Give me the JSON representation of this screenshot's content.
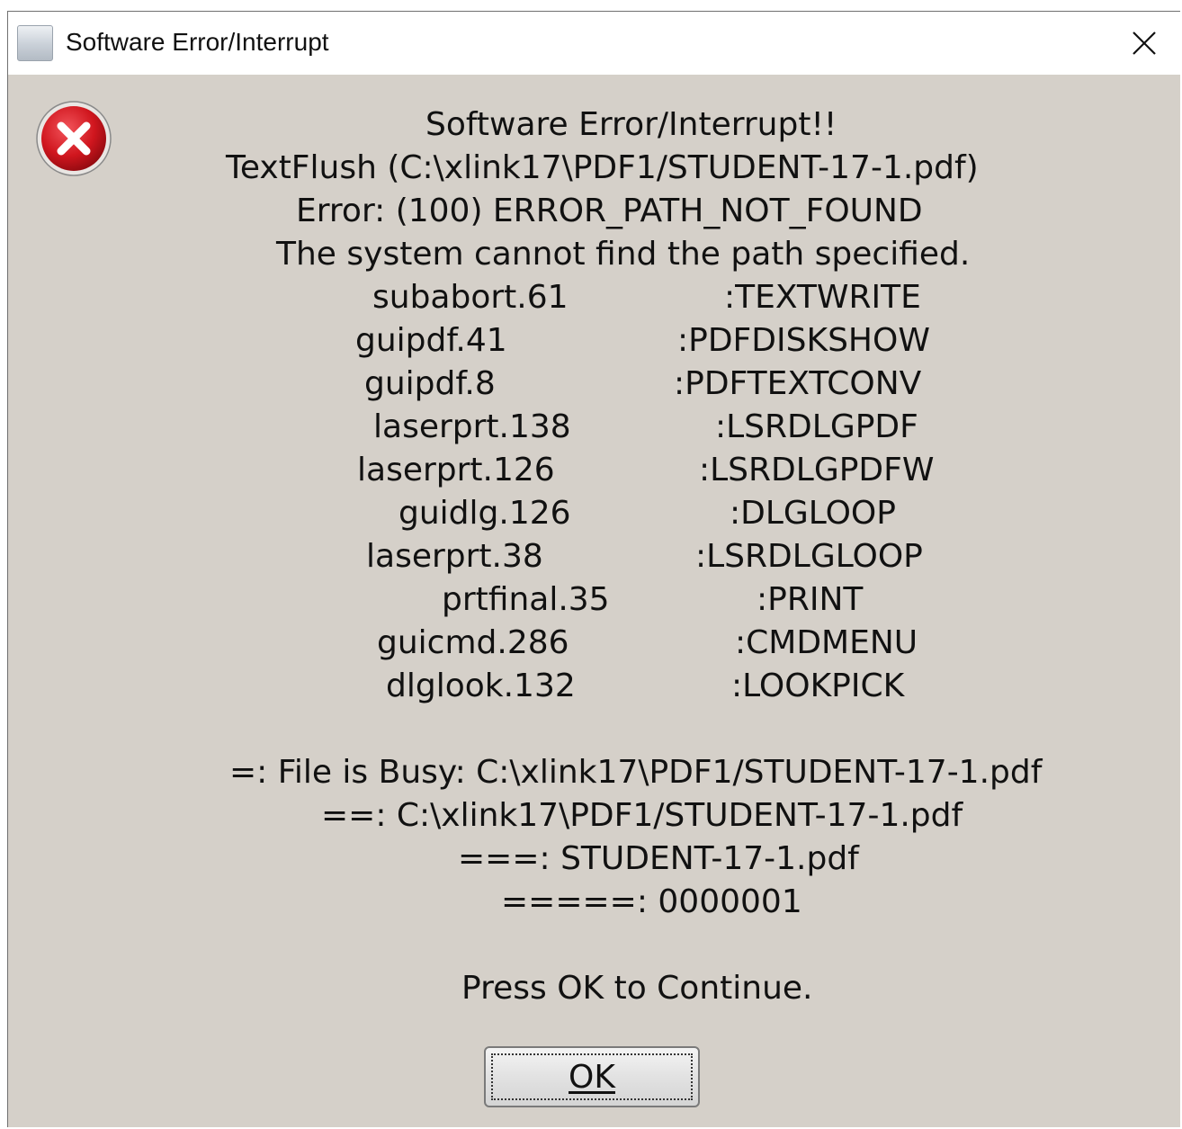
{
  "window": {
    "title": "Software Error/Interrupt"
  },
  "icons": {
    "app": "app-icon",
    "close": "close-icon",
    "error": "error-icon"
  },
  "message": {
    "heading": "Software Error/Interrupt!!",
    "function_line": "TextFlush (C:\\xlink17\\PDF1/STUDENT-17-1.pdf)",
    "error_line": "Error: (100) ERROR_PATH_NOT_FOUND",
    "description": "The system cannot find the path specified.",
    "stack": [
      {
        "location": "subabort.61",
        "routine": ":TEXTWRITE"
      },
      {
        "location": "guipdf.41",
        "routine": ":PDFDISKSHOW"
      },
      {
        "location": "guipdf.8",
        "routine": ":PDFTEXTCONV"
      },
      {
        "location": "laserprt.138",
        "routine": ":LSRDLGPDF"
      },
      {
        "location": "laserprt.126",
        "routine": ":LSRDLGPDFW"
      },
      {
        "location": "guidlg.126",
        "routine": ":DLGLOOP"
      },
      {
        "location": "laserprt.38",
        "routine": ":LSRDLGLOOP"
      },
      {
        "location": "prtfinal.35",
        "routine": ":PRINT"
      },
      {
        "location": "guicmd.286",
        "routine": ":CMDMENU"
      },
      {
        "location": "dlglook.132",
        "routine": ":LOOKPICK"
      }
    ],
    "details": [
      "=: File is Busy: C:\\xlink17\\PDF1/STUDENT-17-1.pdf",
      "==: C:\\xlink17\\PDF1/STUDENT-17-1.pdf",
      "===: STUDENT-17-1.pdf",
      "=====: 0000001"
    ],
    "prompt": "Press OK to Continue."
  },
  "buttons": {
    "ok_label": "OK"
  },
  "colors": {
    "dialog_bg": "#d5d0c9",
    "error_red": "#c8161d"
  }
}
